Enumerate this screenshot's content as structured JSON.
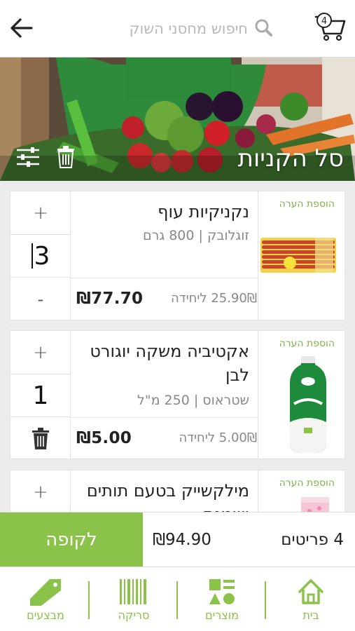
{
  "header": {
    "search_placeholder": "חיפוש מחסני השוק",
    "cart_count": "4"
  },
  "hero": {
    "title": "סל הקניות"
  },
  "items": [
    {
      "name": "נקניקיות עוף",
      "brand_size": "זוגלובק | 800 גרם",
      "unit_price": "25.90₪ ליחידה",
      "total": "₪77.70",
      "quantity": "3",
      "note_link": "הוספת הערה",
      "plus": "+",
      "minus": "-"
    },
    {
      "name": "אקטיביה משקה יוגורט לבן",
      "brand_size": "שטראוס | 250 מ\"ל",
      "unit_price": "5.00₪ ליחידה",
      "total": "₪5.00",
      "quantity": "1",
      "note_link": "הוספת הערה",
      "plus": "+"
    },
    {
      "name": "מילקשייק בטעם תותים ושמנת",
      "note_link": "הוספת הערה",
      "plus": "+"
    }
  ],
  "checkout": {
    "button_label": "לקופה",
    "total": "₪94.90",
    "count": "4 פריטים"
  },
  "nav": {
    "home": "בית",
    "products": "מוצרים",
    "scan": "סריקה",
    "deals": "מבצעים"
  },
  "colors": {
    "accent": "#8bc34a",
    "note_green": "#7cb342"
  }
}
